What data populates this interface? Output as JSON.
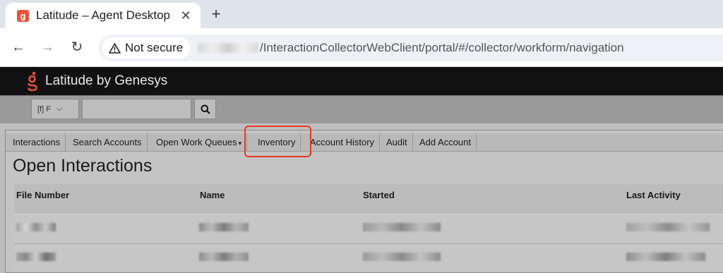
{
  "browser": {
    "tab_title": "Latitude – Agent Desktop",
    "security_label": "Not secure",
    "url_path": "/InteractionCollectorWebClient/portal/#/collector/workform/navigation"
  },
  "app": {
    "brand_title": "Latitude by Genesys",
    "search": {
      "scope_value": "[f]  F"
    }
  },
  "menu": {
    "items": [
      {
        "label": "Interactions"
      },
      {
        "label": "Search Accounts"
      },
      {
        "label": "Open Work Queues"
      },
      {
        "label": "Inventory"
      },
      {
        "label": "Account History"
      },
      {
        "label": "Audit"
      },
      {
        "label": "Add Account"
      }
    ]
  },
  "main": {
    "title": "Open Interactions",
    "columns": [
      "File Number",
      "Name",
      "Started",
      "Last Activity"
    ]
  },
  "colors": {
    "accent": "#e8391e",
    "appbar": "#111111",
    "brand_logo": "#e8533a"
  },
  "icons": [
    "latitude-favicon",
    "close-icon",
    "plus-icon",
    "back-arrow-icon",
    "forward-arrow-icon",
    "reload-icon",
    "warning-icon",
    "genesys-logo-icon",
    "chevron-down-icon",
    "search-icon"
  ]
}
